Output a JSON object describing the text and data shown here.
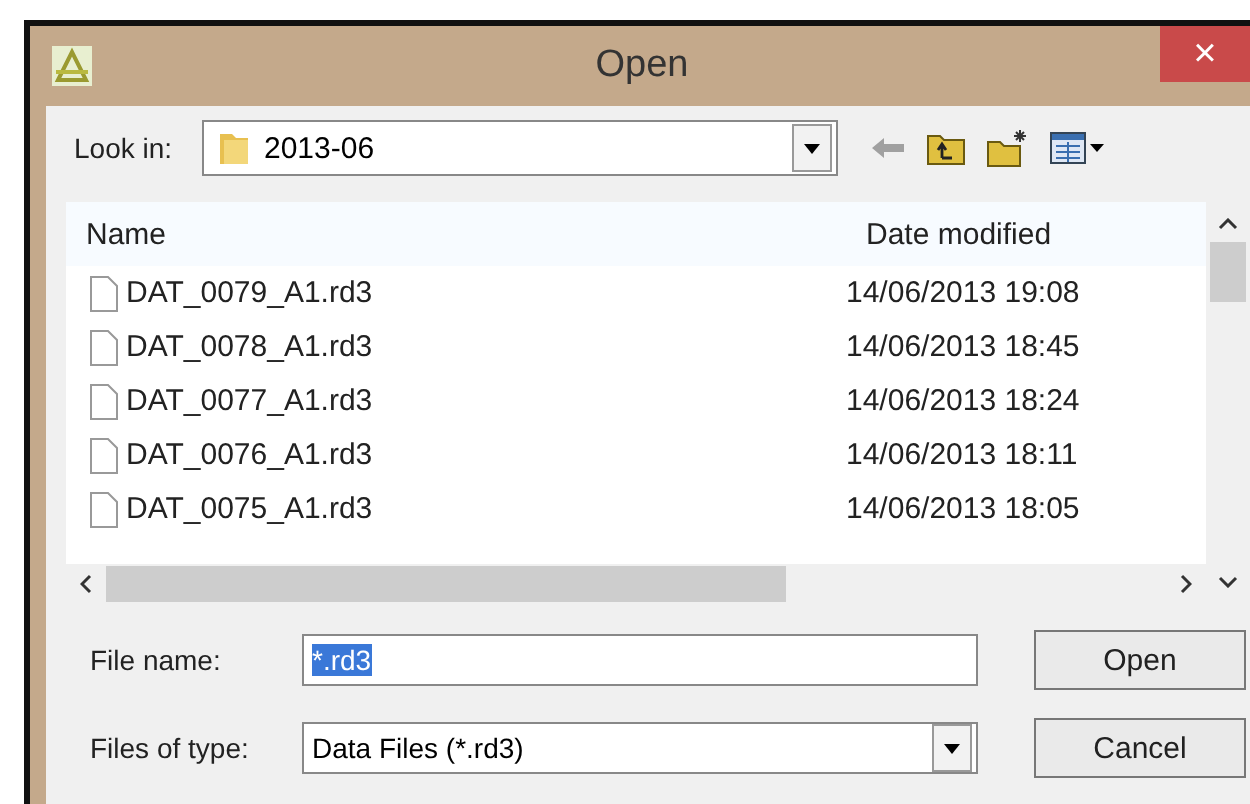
{
  "window": {
    "title": "Open",
    "close": "×"
  },
  "look_in": {
    "label": "Look in:",
    "value": "2013-06"
  },
  "table": {
    "columns": [
      "Name",
      "Date modified"
    ],
    "rows": [
      {
        "name": "DAT_0079_A1.rd3",
        "date": "14/06/2013 19:08"
      },
      {
        "name": "DAT_0078_A1.rd3",
        "date": "14/06/2013 18:45"
      },
      {
        "name": "DAT_0077_A1.rd3",
        "date": "14/06/2013 18:24"
      },
      {
        "name": "DAT_0076_A1.rd3",
        "date": "14/06/2013 18:11"
      },
      {
        "name": "DAT_0075_A1.rd3",
        "date": "14/06/2013 18:05"
      }
    ]
  },
  "file_name": {
    "label": "File name:",
    "value": "*.rd3",
    "text_selected": true
  },
  "file_type": {
    "label": "Files of type:",
    "value": "Data Files (*.rd3)"
  },
  "buttons": [
    "Open",
    "Cancel"
  ]
}
